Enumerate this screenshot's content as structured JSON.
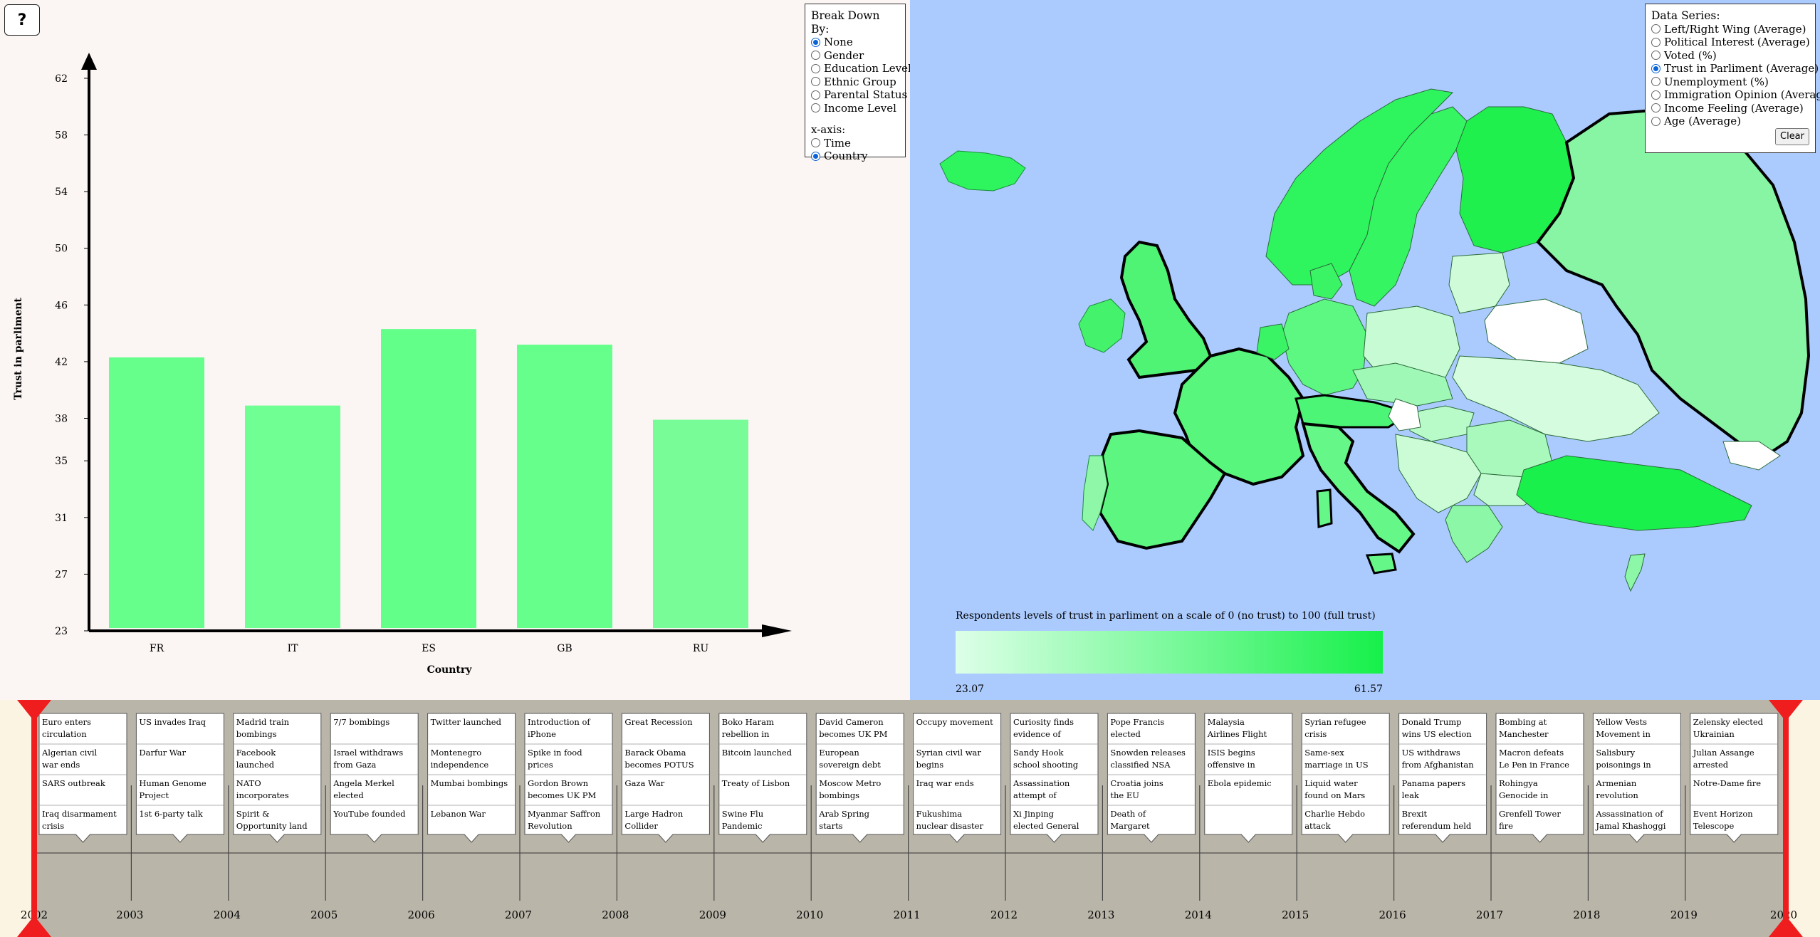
{
  "help_button": {
    "label": "?"
  },
  "breakdown": {
    "title": "Break Down By:",
    "options": [
      "None",
      "Gender",
      "Education Level",
      "Ethnic Group",
      "Parental Status",
      "Income Level"
    ],
    "selected": "None",
    "xaxis_title": "x-axis:",
    "xaxis_options": [
      "Time",
      "Country"
    ],
    "xaxis_selected": "Country"
  },
  "data_series": {
    "title": "Data Series:",
    "options": [
      "Left/Right Wing (Average)",
      "Political Interest (Average)",
      "Voted (%)",
      "Trust in Parliment (Average)",
      "Unemployment (%)",
      "Immigration Opinion (Average)",
      "Income Feeling (Average)",
      "Age (Average)"
    ],
    "selected": "Trust in Parliment (Average)",
    "clear_label": "Clear"
  },
  "chart_data": {
    "type": "bar",
    "categories": [
      "FR",
      "IT",
      "ES",
      "GB",
      "RU"
    ],
    "values": [
      42.3,
      38.9,
      44.3,
      43.2,
      37.9
    ],
    "xlabel": "Country",
    "ylabel": "Trust in parliment",
    "yticks": [
      "23",
      "27",
      "31",
      "35",
      "38",
      "42",
      "46",
      "50",
      "54",
      "58",
      "62"
    ],
    "ylim": [
      23,
      62.5
    ],
    "colors": [
      "#66ff8c",
      "#70ff93",
      "#62ff89",
      "#66ff8c",
      "#78fc98"
    ]
  },
  "map_legend": {
    "title": "Respondents levels of trust in parliment on a scale of 0 (no trust) to 100 (full trust)",
    "min_label": "23.07",
    "max_label": "61.57",
    "colors": [
      "#ddffe8",
      "#16f04a"
    ]
  },
  "timeline": {
    "years": [
      "2002",
      "2003",
      "2004",
      "2005",
      "2006",
      "2007",
      "2008",
      "2009",
      "2010",
      "2011",
      "2012",
      "2013",
      "2014",
      "2015",
      "2016",
      "2017",
      "2018",
      "2019",
      "2020"
    ],
    "events": [
      [
        [
          "Euro enters",
          "circulation"
        ],
        [
          "Algerian civil",
          "war ends"
        ],
        [
          "SARS outbreak"
        ],
        [
          "Iraq disarmament",
          "crisis"
        ]
      ],
      [
        [
          "US invades Iraq"
        ],
        [
          "Darfur War"
        ],
        [
          "Human Genome",
          "Project"
        ],
        [
          "1st 6-party talk"
        ]
      ],
      [
        [
          "Madrid train",
          "bombings"
        ],
        [
          "Facebook",
          "launched"
        ],
        [
          "NATO",
          "incorporates"
        ],
        [
          "Spirit &",
          "Opportunity land"
        ]
      ],
      [
        [
          "7/7 bombings"
        ],
        [
          "Israel withdraws",
          "from Gaza"
        ],
        [
          "Angela Merkel",
          "elected"
        ],
        [
          "YouTube founded"
        ]
      ],
      [
        [
          "Twitter launched"
        ],
        [
          "Montenegro",
          "independence"
        ],
        [
          "Mumbai bombings"
        ],
        [
          "Lebanon War"
        ]
      ],
      [
        [
          "Introduction of",
          "iPhone"
        ],
        [
          "Spike in food",
          "prices"
        ],
        [
          "Gordon Brown",
          "becomes UK PM"
        ],
        [
          "Myanmar Saffron",
          "Revolution"
        ]
      ],
      [
        [
          "Great Recession"
        ],
        [
          "Barack Obama",
          "becomes POTUS"
        ],
        [
          "Gaza War"
        ],
        [
          "Large Hadron",
          "Collider"
        ]
      ],
      [
        [
          "Boko Haram",
          "rebellion in"
        ],
        [
          "Bitcoin launched"
        ],
        [
          "Treaty of Lisbon"
        ],
        [
          "Swine Flu",
          "Pandemic"
        ]
      ],
      [
        [
          "David Cameron",
          "becomes UK PM"
        ],
        [
          "European",
          "sovereign debt"
        ],
        [
          "Moscow Metro",
          "bombings"
        ],
        [
          "Arab Spring",
          "starts"
        ]
      ],
      [
        [
          "Occupy movement"
        ],
        [
          "Syrian civil war",
          "begins"
        ],
        [
          "Iraq war ends"
        ],
        [
          "Fukushima",
          "nuclear disaster"
        ]
      ],
      [
        [
          "Curiosity finds",
          "evidence of"
        ],
        [
          "Sandy Hook",
          "school shooting"
        ],
        [
          "Assassination",
          "attempt of"
        ],
        [
          "Xi Jinping",
          "elected General"
        ]
      ],
      [
        [
          "Pope Francis",
          "elected"
        ],
        [
          "Snowden releases",
          "classified NSA"
        ],
        [
          "Croatia joins",
          "the EU"
        ],
        [
          "Death of",
          "Margaret"
        ]
      ],
      [
        [
          "Malaysia",
          "Airlines Flight"
        ],
        [
          "ISIS begins",
          "offensive in"
        ],
        [
          "Ebola epidemic"
        ],
        [
          ""
        ]
      ],
      [
        [
          "Syrian refugee",
          "crisis"
        ],
        [
          "Same-sex",
          "marriage in US"
        ],
        [
          "Liquid water",
          "found on Mars"
        ],
        [
          "Charlie Hebdo",
          "attack"
        ]
      ],
      [
        [
          "Donald Trump",
          "wins US election"
        ],
        [
          "US withdraws",
          "from Afghanistan"
        ],
        [
          "Panama papers",
          "leak"
        ],
        [
          "Brexit",
          "referendum held"
        ]
      ],
      [
        [
          "Bombing at",
          "Manchester"
        ],
        [
          "Macron defeats",
          "Le Pen in France"
        ],
        [
          "Rohingya",
          "Genocide in"
        ],
        [
          "Grenfell Tower",
          "fire"
        ]
      ],
      [
        [
          "Yellow Vests",
          "Movement in"
        ],
        [
          "Salisbury",
          "poisonings in"
        ],
        [
          "Armenian",
          "revolution"
        ],
        [
          "Assassination of",
          "Jamal Khashoggi"
        ]
      ],
      [
        [
          "Zelensky elected",
          "Ukrainian"
        ],
        [
          "Julian Assange",
          "arrested"
        ],
        [
          "Notre-Dame fire"
        ],
        [
          "Event Horizon",
          "Telescope"
        ]
      ]
    ]
  }
}
